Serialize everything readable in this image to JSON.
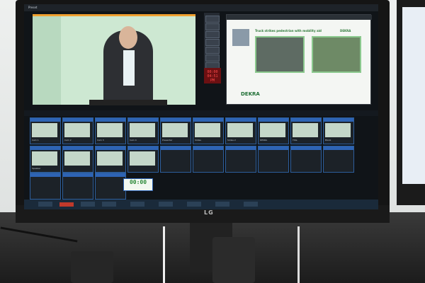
{
  "screen": {
    "app_title": "Preset",
    "program": {
      "headline": "Truck strikes pedestrian with mobility aid",
      "logo_top": "DEKRA",
      "logo_bottom": "DEKRA"
    },
    "timer": {
      "line1": "00:00",
      "line2": "04:51 PM"
    },
    "tiles": [
      {
        "label": "Cam 1"
      },
      {
        "label": "Cam 2"
      },
      {
        "label": "Cam 3"
      },
      {
        "label": "Cam 4"
      },
      {
        "label": "Presenter"
      },
      {
        "label": "Slides"
      },
      {
        "label": "Slides 2"
      },
      {
        "label": "DEKRA"
      },
      {
        "label": "Title"
      },
      {
        "label": "Blank"
      },
      {
        "label": "Speaker"
      }
    ],
    "clock_badge": "00:00"
  },
  "monitor": {
    "brand": "LG"
  },
  "colors": {
    "preview_border": "#f0a030",
    "tile_accent": "#2e64b4",
    "dekra_green": "#2f7a3a"
  }
}
